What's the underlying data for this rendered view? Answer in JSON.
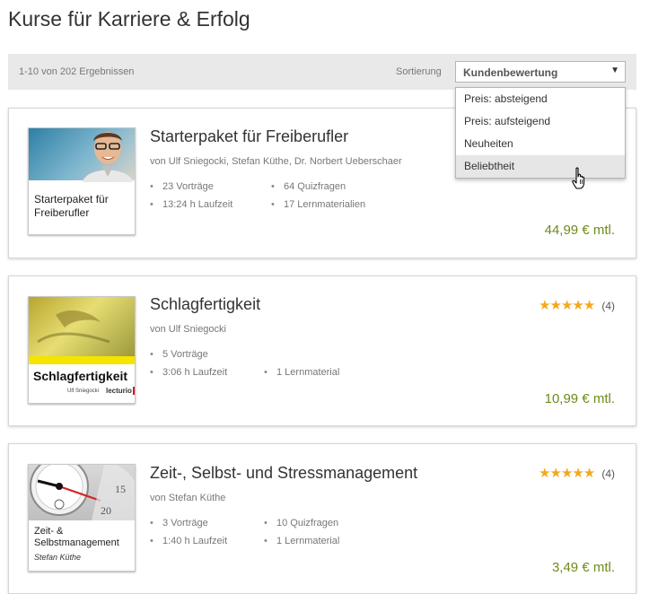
{
  "page": {
    "title": "Kurse für Karriere & Erfolg"
  },
  "toolbar": {
    "result_count": "1-10 von 202 Ergebnissen",
    "sort_label": "Sortierung",
    "sort_selected": "Kundenbewertung",
    "sort_options": [
      "Preis: absteigend",
      "Preis: aufsteigend",
      "Neuheiten",
      "Beliebtheit"
    ],
    "hovered_option": "Beliebtheit"
  },
  "courses": [
    {
      "title": "Starterpaket für Freiberufler",
      "author": "von Ulf Sniegocki, Stefan Küthe, Dr. Norbert Ueberschaer",
      "facts": [
        "23 Vorträge",
        "64 Quizfragen",
        "13:24 h Laufzeit",
        "17 Lernmaterialien"
      ],
      "price": "44,99  € mtl.",
      "thumb_text": "Starterpaket für Freiberufler"
    },
    {
      "title": "Schlagfertigkeit",
      "author": "von Ulf Sniegocki",
      "facts": [
        "5 Vorträge",
        "3:06 h Laufzeit",
        "1 Lernmaterial"
      ],
      "price": "10,99  € mtl.",
      "rating_stars": 5,
      "rating_count": "(4)",
      "thumb_text": "Schlagfertigkeit",
      "thumb_author": "Ulf Sniegocki",
      "thumb_logo": "lecturio"
    },
    {
      "title": "Zeit-, Selbst- und Stressmanagement",
      "author": "von Stefan Küthe",
      "facts": [
        "3 Vorträge",
        "10 Quizfragen",
        "1:40 h Laufzeit",
        "1 Lernmaterial"
      ],
      "price": "3,49  € mtl.",
      "rating_stars": 5,
      "rating_count": "(4)",
      "thumb_text": "Zeit- & Selbstmanagement",
      "thumb_author": "Stefan Küthe",
      "thumb_clock": [
        "15",
        "20"
      ]
    }
  ],
  "colors": {
    "price": "#6e8b1a",
    "stars": "#f4a81d",
    "toolbar_bg": "#e9e9e9"
  },
  "icons": {
    "cursor": "hand-pointer-icon",
    "caret": "caret-down-icon",
    "star": "star-icon"
  }
}
